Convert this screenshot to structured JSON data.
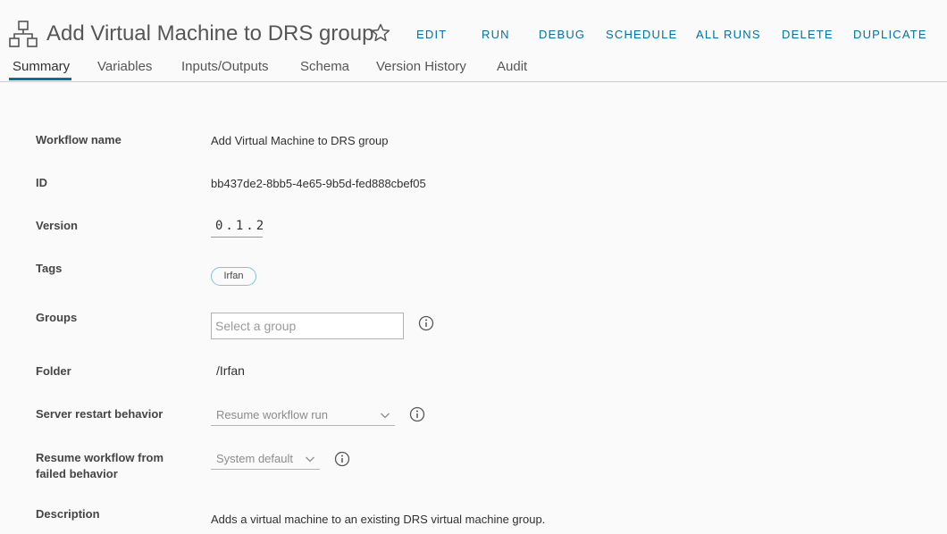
{
  "header": {
    "title": "Add Virtual Machine to DRS group"
  },
  "actions": {
    "edit": "EDIT",
    "run": "RUN",
    "debug": "DEBUG",
    "schedule": "SCHEDULE",
    "all_runs": "ALL RUNS",
    "delete": "DELETE",
    "duplicate": "DUPLICATE"
  },
  "tabs": [
    {
      "label": "Summary",
      "active": true
    },
    {
      "label": "Variables",
      "active": false
    },
    {
      "label": "Inputs/Outputs",
      "active": false
    },
    {
      "label": "Schema",
      "active": false
    },
    {
      "label": "Version History",
      "active": false
    },
    {
      "label": "Audit",
      "active": false
    }
  ],
  "summary": {
    "workflow_name": {
      "label": "Workflow name",
      "value": "Add Virtual Machine to DRS group"
    },
    "id": {
      "label": "ID",
      "value": "bb437de2-8bb5-4e65-9b5d-fed888cbef05"
    },
    "version": {
      "label": "Version",
      "value": "0.1.2"
    },
    "tags": {
      "label": "Tags",
      "items": [
        "Irfan"
      ]
    },
    "groups": {
      "label": "Groups",
      "placeholder": "Select a group",
      "value": ""
    },
    "folder": {
      "label": "Folder",
      "value": "/Irfan"
    },
    "server_restart": {
      "label": "Server restart behavior",
      "value": "Resume workflow run"
    },
    "resume_failed": {
      "label_line1": "Resume workflow from",
      "label_line2": "failed behavior",
      "value": "System default"
    },
    "description": {
      "label": "Description",
      "value": "Adds a virtual machine to an existing DRS virtual machine group."
    }
  },
  "colors": {
    "accent": "#0072a3",
    "tag_border": "#7ac7d9",
    "background": "#fafafa"
  },
  "icons": {
    "workflow": "workflow-icon",
    "favorite": "star-icon",
    "info": "info-icon",
    "dropdown": "chevron-down-icon"
  }
}
